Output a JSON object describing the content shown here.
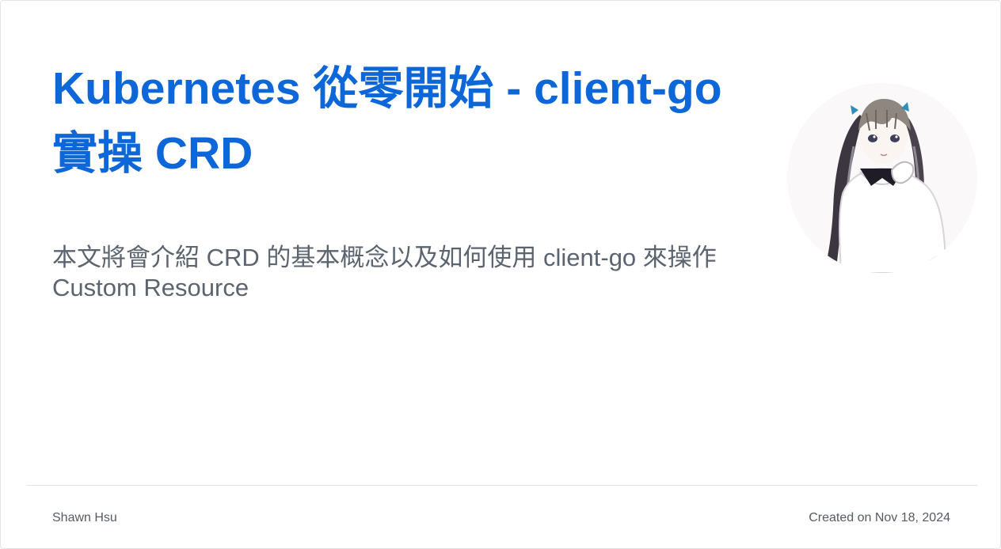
{
  "post": {
    "title": "Kubernetes 從零開始 - client-go 實操 CRD",
    "description": "本文將會介紹 CRD 的基本概念以及如何使用 client-go 來操作 Custom Resource"
  },
  "footer": {
    "author": "Shawn Hsu",
    "created": "Created on Nov 18, 2024"
  },
  "avatar": {
    "icon": "anime-character-avatar"
  },
  "colors": {
    "title": "#0d67d8",
    "text": "#5c6470",
    "footer_text": "#555b63",
    "divider": "#e2e2e2"
  }
}
